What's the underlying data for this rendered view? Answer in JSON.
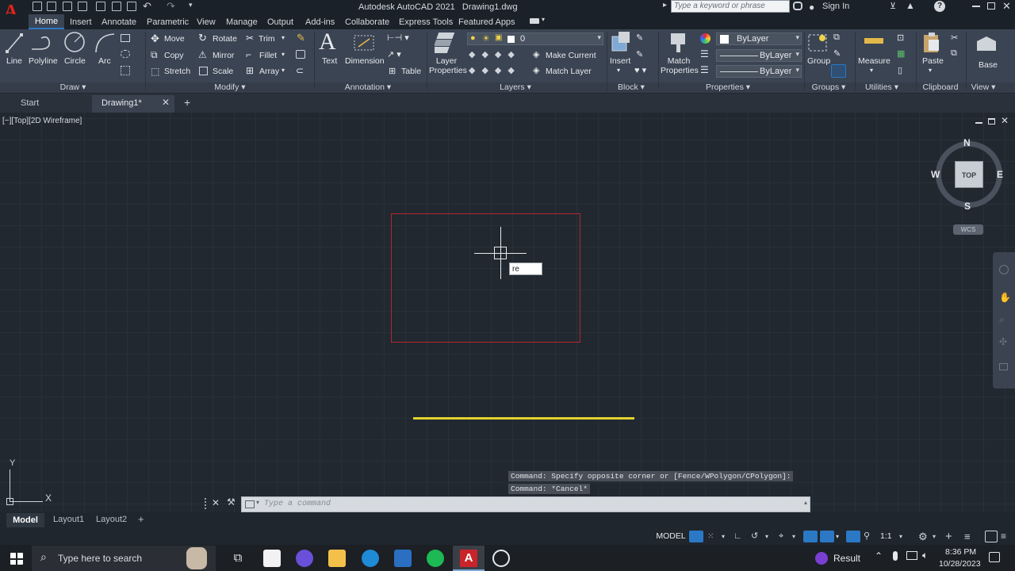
{
  "app": {
    "title": "Autodesk AutoCAD 2021",
    "document": "Drawing1.dwg",
    "search_placeholder": "Type a keyword or phrase",
    "sign_in": "Sign In"
  },
  "tabs": [
    "Home",
    "Insert",
    "Annotate",
    "Parametric",
    "View",
    "Manage",
    "Output",
    "Add-ins",
    "Collaborate",
    "Express Tools",
    "Featured Apps"
  ],
  "ribbon": {
    "draw": {
      "line": "Line",
      "polyline": "Polyline",
      "circle": "Circle",
      "arc": "Arc",
      "label": "Draw"
    },
    "modify": {
      "move": "Move",
      "rotate": "Rotate",
      "trim": "Trim",
      "copy": "Copy",
      "mirror": "Mirror",
      "fillet": "Fillet",
      "stretch": "Stretch",
      "scale": "Scale",
      "array": "Array",
      "label": "Modify"
    },
    "annotation": {
      "text": "Text",
      "dimension": "Dimension",
      "table": "Table",
      "label": "Annotation"
    },
    "layers": {
      "properties1": "Layer",
      "properties2": "Properties",
      "current_layer": "0",
      "make_current": "Make Current",
      "match_layer": "Match Layer",
      "label": "Layers"
    },
    "block": {
      "insert": "Insert",
      "label": "Block"
    },
    "properties": {
      "match1": "Match",
      "match2": "Properties",
      "color": "ByLayer",
      "linetype": "ByLayer",
      "lineweight": "ByLayer",
      "label": "Properties"
    },
    "groups": {
      "group": "Group",
      "label": "Groups"
    },
    "utilities": {
      "measure": "Measure",
      "label": "Utilities"
    },
    "clipboard": {
      "paste": "Paste",
      "label": "Clipboard"
    },
    "view": {
      "base": "Base",
      "label": "View"
    }
  },
  "file_tabs": {
    "start": "Start",
    "drawing": "Drawing1*"
  },
  "viewport": {
    "label": "[−][Top][2D Wireframe]",
    "cursor_input": "re"
  },
  "viewcube": {
    "n": "N",
    "s": "S",
    "e": "E",
    "w": "W",
    "top": "TOP",
    "wcs": "WCS"
  },
  "ucs": {
    "x": "X",
    "y": "Y"
  },
  "command": {
    "history1": "Command: Specify opposite corner or [Fence/WPolygon/CPolygon]:",
    "history2": "Command: *Cancel*",
    "placeholder": "Type a command"
  },
  "layouts": [
    "Model",
    "Layout1",
    "Layout2"
  ],
  "status": {
    "model": "MODEL",
    "scale": "1:1"
  },
  "taskbar": {
    "search_placeholder": "Type here to search",
    "result": "Result",
    "time": "8:36 PM",
    "date": "10/28/2023"
  },
  "colors": {
    "selection_rect": "#b3262b",
    "line": "#e3d22d",
    "ribbon": "#3b4453",
    "canvas": "#212830",
    "accent": "#2b78c5"
  }
}
